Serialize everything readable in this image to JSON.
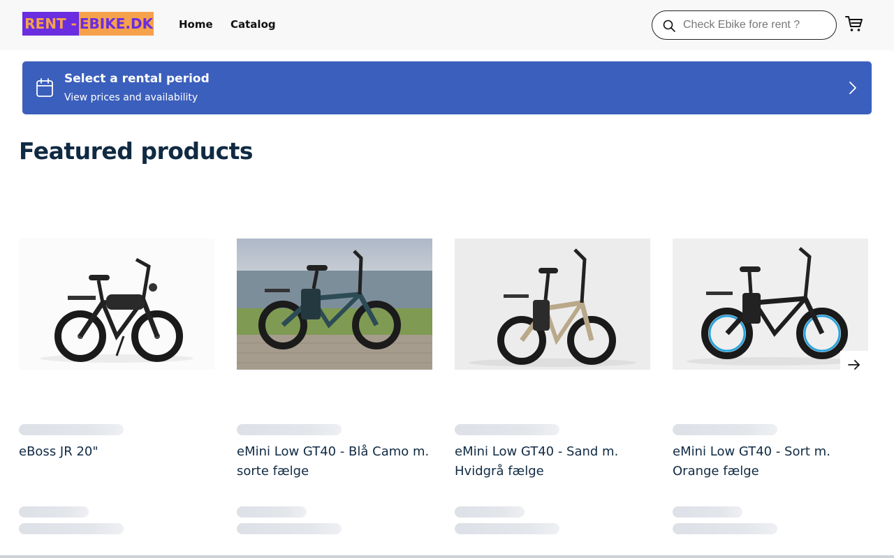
{
  "header": {
    "logo_part1": "RENT -",
    "logo_part2": "EBIKE.DK",
    "nav": [
      {
        "label": "Home"
      },
      {
        "label": "Catalog"
      }
    ],
    "search_placeholder": "Check Ebike fore rent ?",
    "search_value": "",
    "cart_icon": "cart-icon"
  },
  "banner": {
    "title": "Select a rental period",
    "subtitle": "View prices and availability",
    "icon": "calendar-icon",
    "color": "#3b5fbc"
  },
  "featured": {
    "title": "Featured products",
    "products": [
      {
        "name": "eBoss JR 20\""
      },
      {
        "name": "eMini Low GT40 - Blå Camo m. sorte fælge"
      },
      {
        "name": "eMini Low GT40 - Sand m. Hvidgrå fælge"
      },
      {
        "name": "eMini Low GT40 - Sort m. Orange fælge"
      }
    ]
  },
  "colors": {
    "brand_purple": "#6a2de0",
    "brand_orange": "#f6a14b",
    "heading": "#102a43",
    "skeleton": "#dde1e7"
  }
}
